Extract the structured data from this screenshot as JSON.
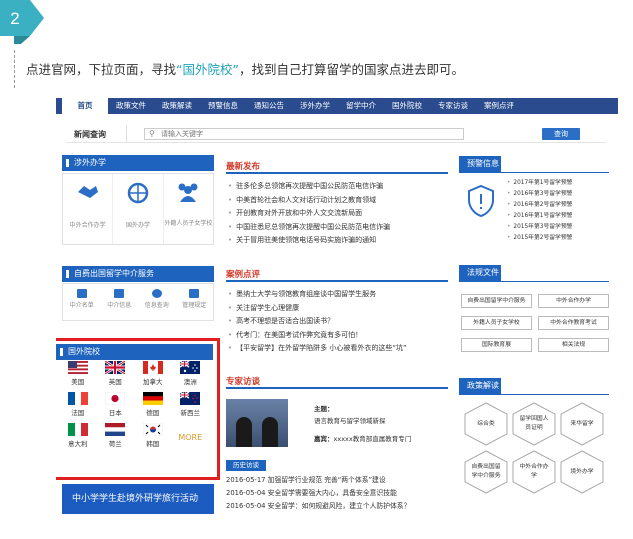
{
  "step": {
    "number": "2"
  },
  "instruction": {
    "before": "点进官网，下拉页面，寻找",
    "highlight": "“国外院校”",
    "after": "，找到自己打算留学的国家点进去即可。"
  },
  "site": {
    "nav": [
      "首页",
      "政策文件",
      "政策解读",
      "预警信息",
      "通知公告",
      "涉外办学",
      "留学中介",
      "国外院校",
      "专家访谈",
      "案例点评"
    ],
    "search": {
      "title": "新闻查询",
      "placeholder": "请输入关键字",
      "button": "查询"
    },
    "foreign_school": {
      "title": "涉外办学",
      "items": [
        "中外合作办学",
        "国外办学",
        "外籍人员子女学校"
      ]
    },
    "agency": {
      "title": "自费出国留学中介服务",
      "items": [
        "中介名单",
        "中介信息",
        "信息查询",
        "管理规定"
      ]
    },
    "countries": {
      "title": "国外院校",
      "list": [
        "美国",
        "英国",
        "加拿大",
        "澳洲",
        "法国",
        "日本",
        "德国",
        "新西兰",
        "意大利",
        "荷兰",
        "韩国"
      ],
      "more": "MORE"
    },
    "banner": "中小学学生赴境外研学旅行活动",
    "latest": {
      "title": "最新发布",
      "items": [
        "驻多伦多总领馆再次提醒中国公民防范电信诈骗",
        "中美首轮社会和人文对话行动计划之教育领域",
        "开创教育对外开放和中外人文交流新局面",
        "中国驻悉尼总领馆再次提醒中国公民防范电信诈骗",
        "关于冒用驻美使领馆电话号码实施诈骗的通知"
      ]
    },
    "cases": {
      "title": "案例点评",
      "items": [
        "墨纳士大学与领馆教育组座谈中国留学生服务",
        "关注留学生心理健康",
        "高考不理想是否适合出国读书？",
        "代考门：在美国考试作弊究竟有多可怕！",
        "【平安留学】在外留学陷阱多 小心被看外衣的这些“坑”"
      ]
    },
    "expert": {
      "title": "专家访谈",
      "topic_label": "主题：",
      "topic": "语言教育与留学领域新探",
      "guest_label": "嘉宾：",
      "guest": "xxxxx教育部直属教育专门",
      "tag": "历史访谈",
      "items": [
        "2016-05-17   加强留学行业规范 完善“两个体系”建设",
        "2016-05-04   安全留学需要强大内心，具备安全意识技能",
        "2016-05-04   安全留学：如何规避风险，建立个人防护体系？"
      ]
    },
    "warnings": {
      "title": "预警信息",
      "items": [
        "2017年第1号留学预警",
        "2016年第3号留学预警",
        "2016年第2号留学预警",
        "2016年第1号留学预警",
        "2015年第3号留学预警",
        "2015年第2号留学预警"
      ]
    },
    "law": {
      "title": "法规文件",
      "items": [
        "自费出国留学中介服务",
        "中外合作办学",
        "外籍人员子女学校",
        "中外合作教育考试",
        "国际教育展",
        "相关法规"
      ]
    },
    "policy": {
      "title": "政策解读",
      "items": [
        "综合类",
        "留学回国人员证明",
        "来华留学",
        "自费出国留学中介服务",
        "中外合作办学",
        "境外办学"
      ]
    },
    "colors": {
      "primary": "#1e63bd",
      "highlight": "#1fa2b5",
      "red_frame": "#e02020"
    }
  }
}
